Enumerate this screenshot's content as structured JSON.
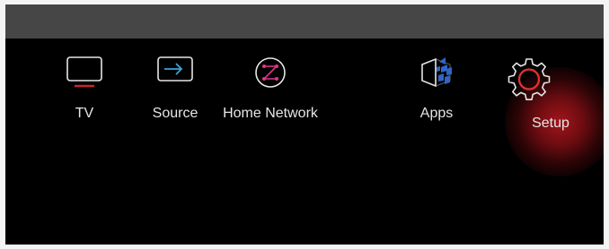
{
  "menu": {
    "items": [
      {
        "label": "TV",
        "icon": "tv-icon",
        "selected": false
      },
      {
        "label": "Source",
        "icon": "source-icon",
        "selected": false
      },
      {
        "label": "Home Network",
        "icon": "home-network-icon",
        "selected": false
      },
      {
        "label": "Apps",
        "icon": "apps-icon",
        "selected": false
      },
      {
        "label": "Setup",
        "icon": "gear-icon",
        "selected": true
      }
    ]
  },
  "colors": {
    "accent": "#d9342b",
    "tv_underline": "#c6262b",
    "source_arrow": "#3fa3d4",
    "network_ring": "#e1338c",
    "apps_blue": "#2f66c7",
    "setup_glow": "#a8151c"
  }
}
